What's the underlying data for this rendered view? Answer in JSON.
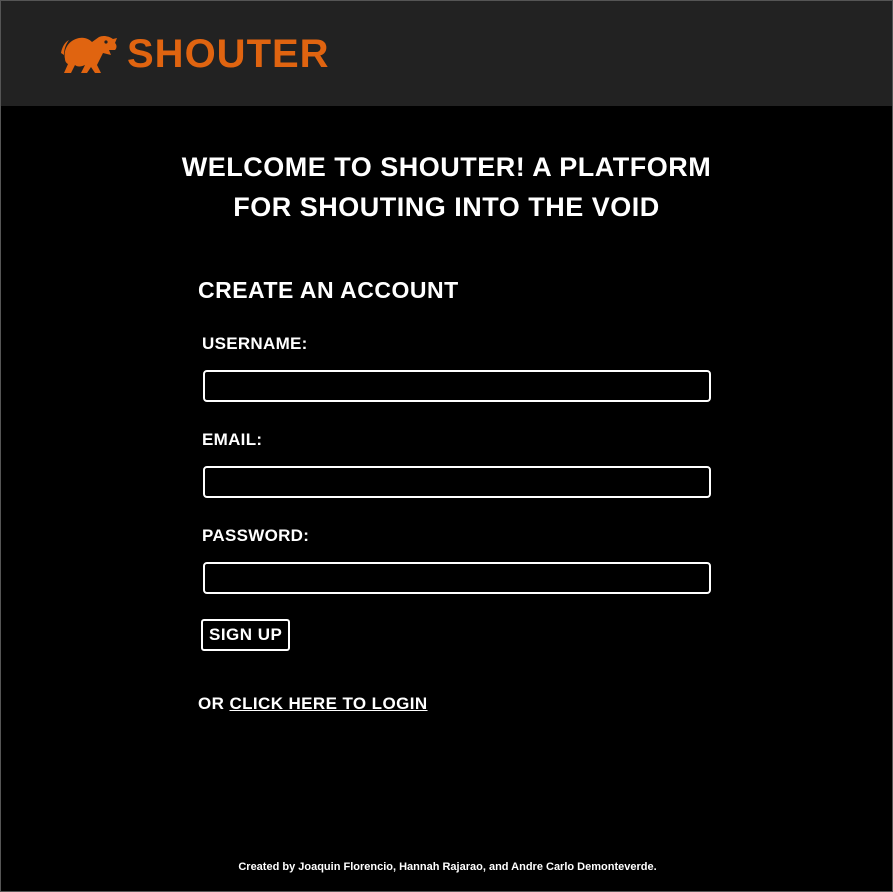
{
  "brand": {
    "name": "SHOUTER",
    "color": "#E06410",
    "logo_icon": "shouting-creature-icon"
  },
  "welcome": {
    "line1": "WELCOME TO SHOUTER! A PLATFORM",
    "line2": "FOR SHOUTING INTO THE VOID"
  },
  "form": {
    "title": "CREATE AN ACCOUNT",
    "username_label": "USERNAME:",
    "username_value": "",
    "email_label": "EMAIL:",
    "email_value": "",
    "password_label": "PASSWORD:",
    "password_value": "",
    "submit_label": "SIGN UP"
  },
  "login": {
    "prefix": "OR",
    "link_label": "CLICK HERE TO LOGIN"
  },
  "footer": {
    "credits": "Created by Joaquin Florencio, Hannah Rajarao, and Andre Carlo Demonteverde."
  },
  "colors": {
    "header_bg": "#222222",
    "page_bg": "#000000",
    "text": "#FFFFFF"
  }
}
